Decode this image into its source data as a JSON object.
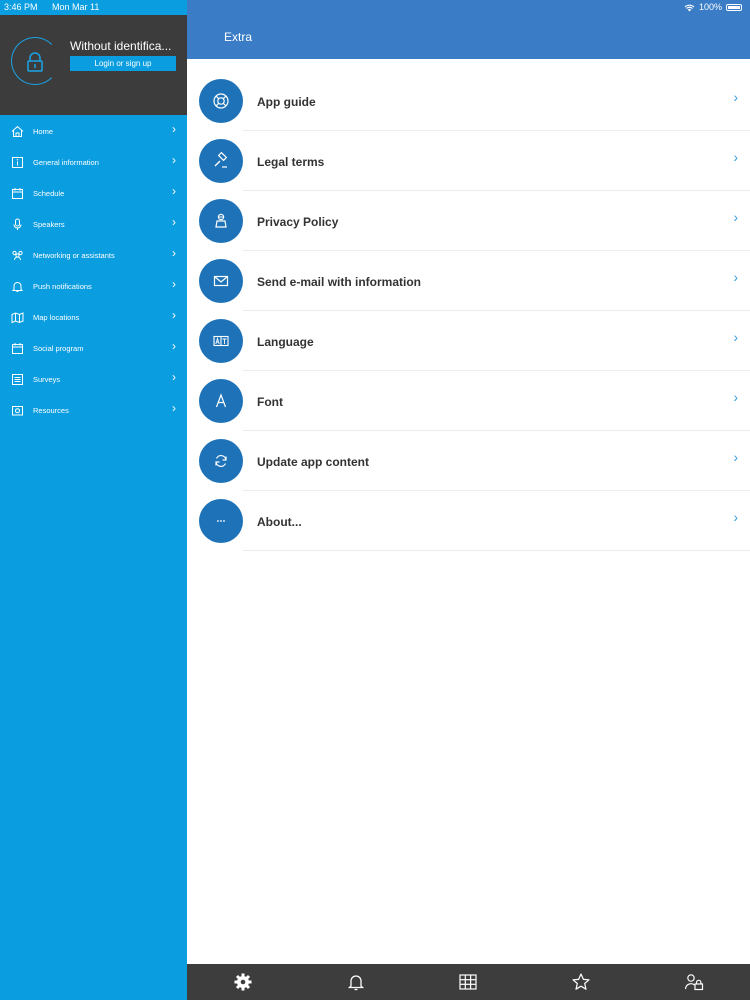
{
  "status_bar": {
    "time": "3:46 PM",
    "date": "Mon Mar 11",
    "battery": "100%"
  },
  "profile": {
    "name": "Without identifica...",
    "login_label": "Login or sign up"
  },
  "sidebar": {
    "items": [
      {
        "label": "Home",
        "icon": "home-icon"
      },
      {
        "label": "General information",
        "icon": "info-icon"
      },
      {
        "label": "Schedule",
        "icon": "calendar-icon"
      },
      {
        "label": "Speakers",
        "icon": "microphone-icon"
      },
      {
        "label": "Networking or assistants",
        "icon": "people-icon"
      },
      {
        "label": "Push notifications",
        "icon": "bell-icon"
      },
      {
        "label": "Map locations",
        "icon": "map-icon"
      },
      {
        "label": "Social program",
        "icon": "calendar-icon"
      },
      {
        "label": "Surveys",
        "icon": "list-icon"
      },
      {
        "label": "Resources",
        "icon": "image-icon"
      }
    ]
  },
  "header": {
    "title": "Extra"
  },
  "list": {
    "items": [
      {
        "label": "App guide",
        "icon": "lifebuoy-icon"
      },
      {
        "label": "Legal terms",
        "icon": "gavel-icon"
      },
      {
        "label": "Privacy Policy",
        "icon": "privacy-icon"
      },
      {
        "label": "Send e-mail with information",
        "icon": "envelope-icon"
      },
      {
        "label": "Language",
        "icon": "translate-icon"
      },
      {
        "label": "Font",
        "icon": "font-icon"
      },
      {
        "label": "Update app content",
        "icon": "refresh-icon"
      },
      {
        "label": "About...",
        "icon": "more-icon"
      }
    ]
  },
  "tabbar": {
    "tabs": [
      {
        "icon": "gear-icon",
        "active": true
      },
      {
        "icon": "bell-icon",
        "active": false
      },
      {
        "icon": "grid-icon",
        "active": false
      },
      {
        "icon": "star-icon",
        "active": false
      },
      {
        "icon": "profile-lock-icon",
        "active": false
      }
    ]
  },
  "colors": {
    "sidebar": "#0a9de0",
    "header": "#3a7dc6",
    "profile_bg": "#3c3c3c",
    "tabbar": "#3d3d3d",
    "icon_circle": "#1e73b8"
  }
}
